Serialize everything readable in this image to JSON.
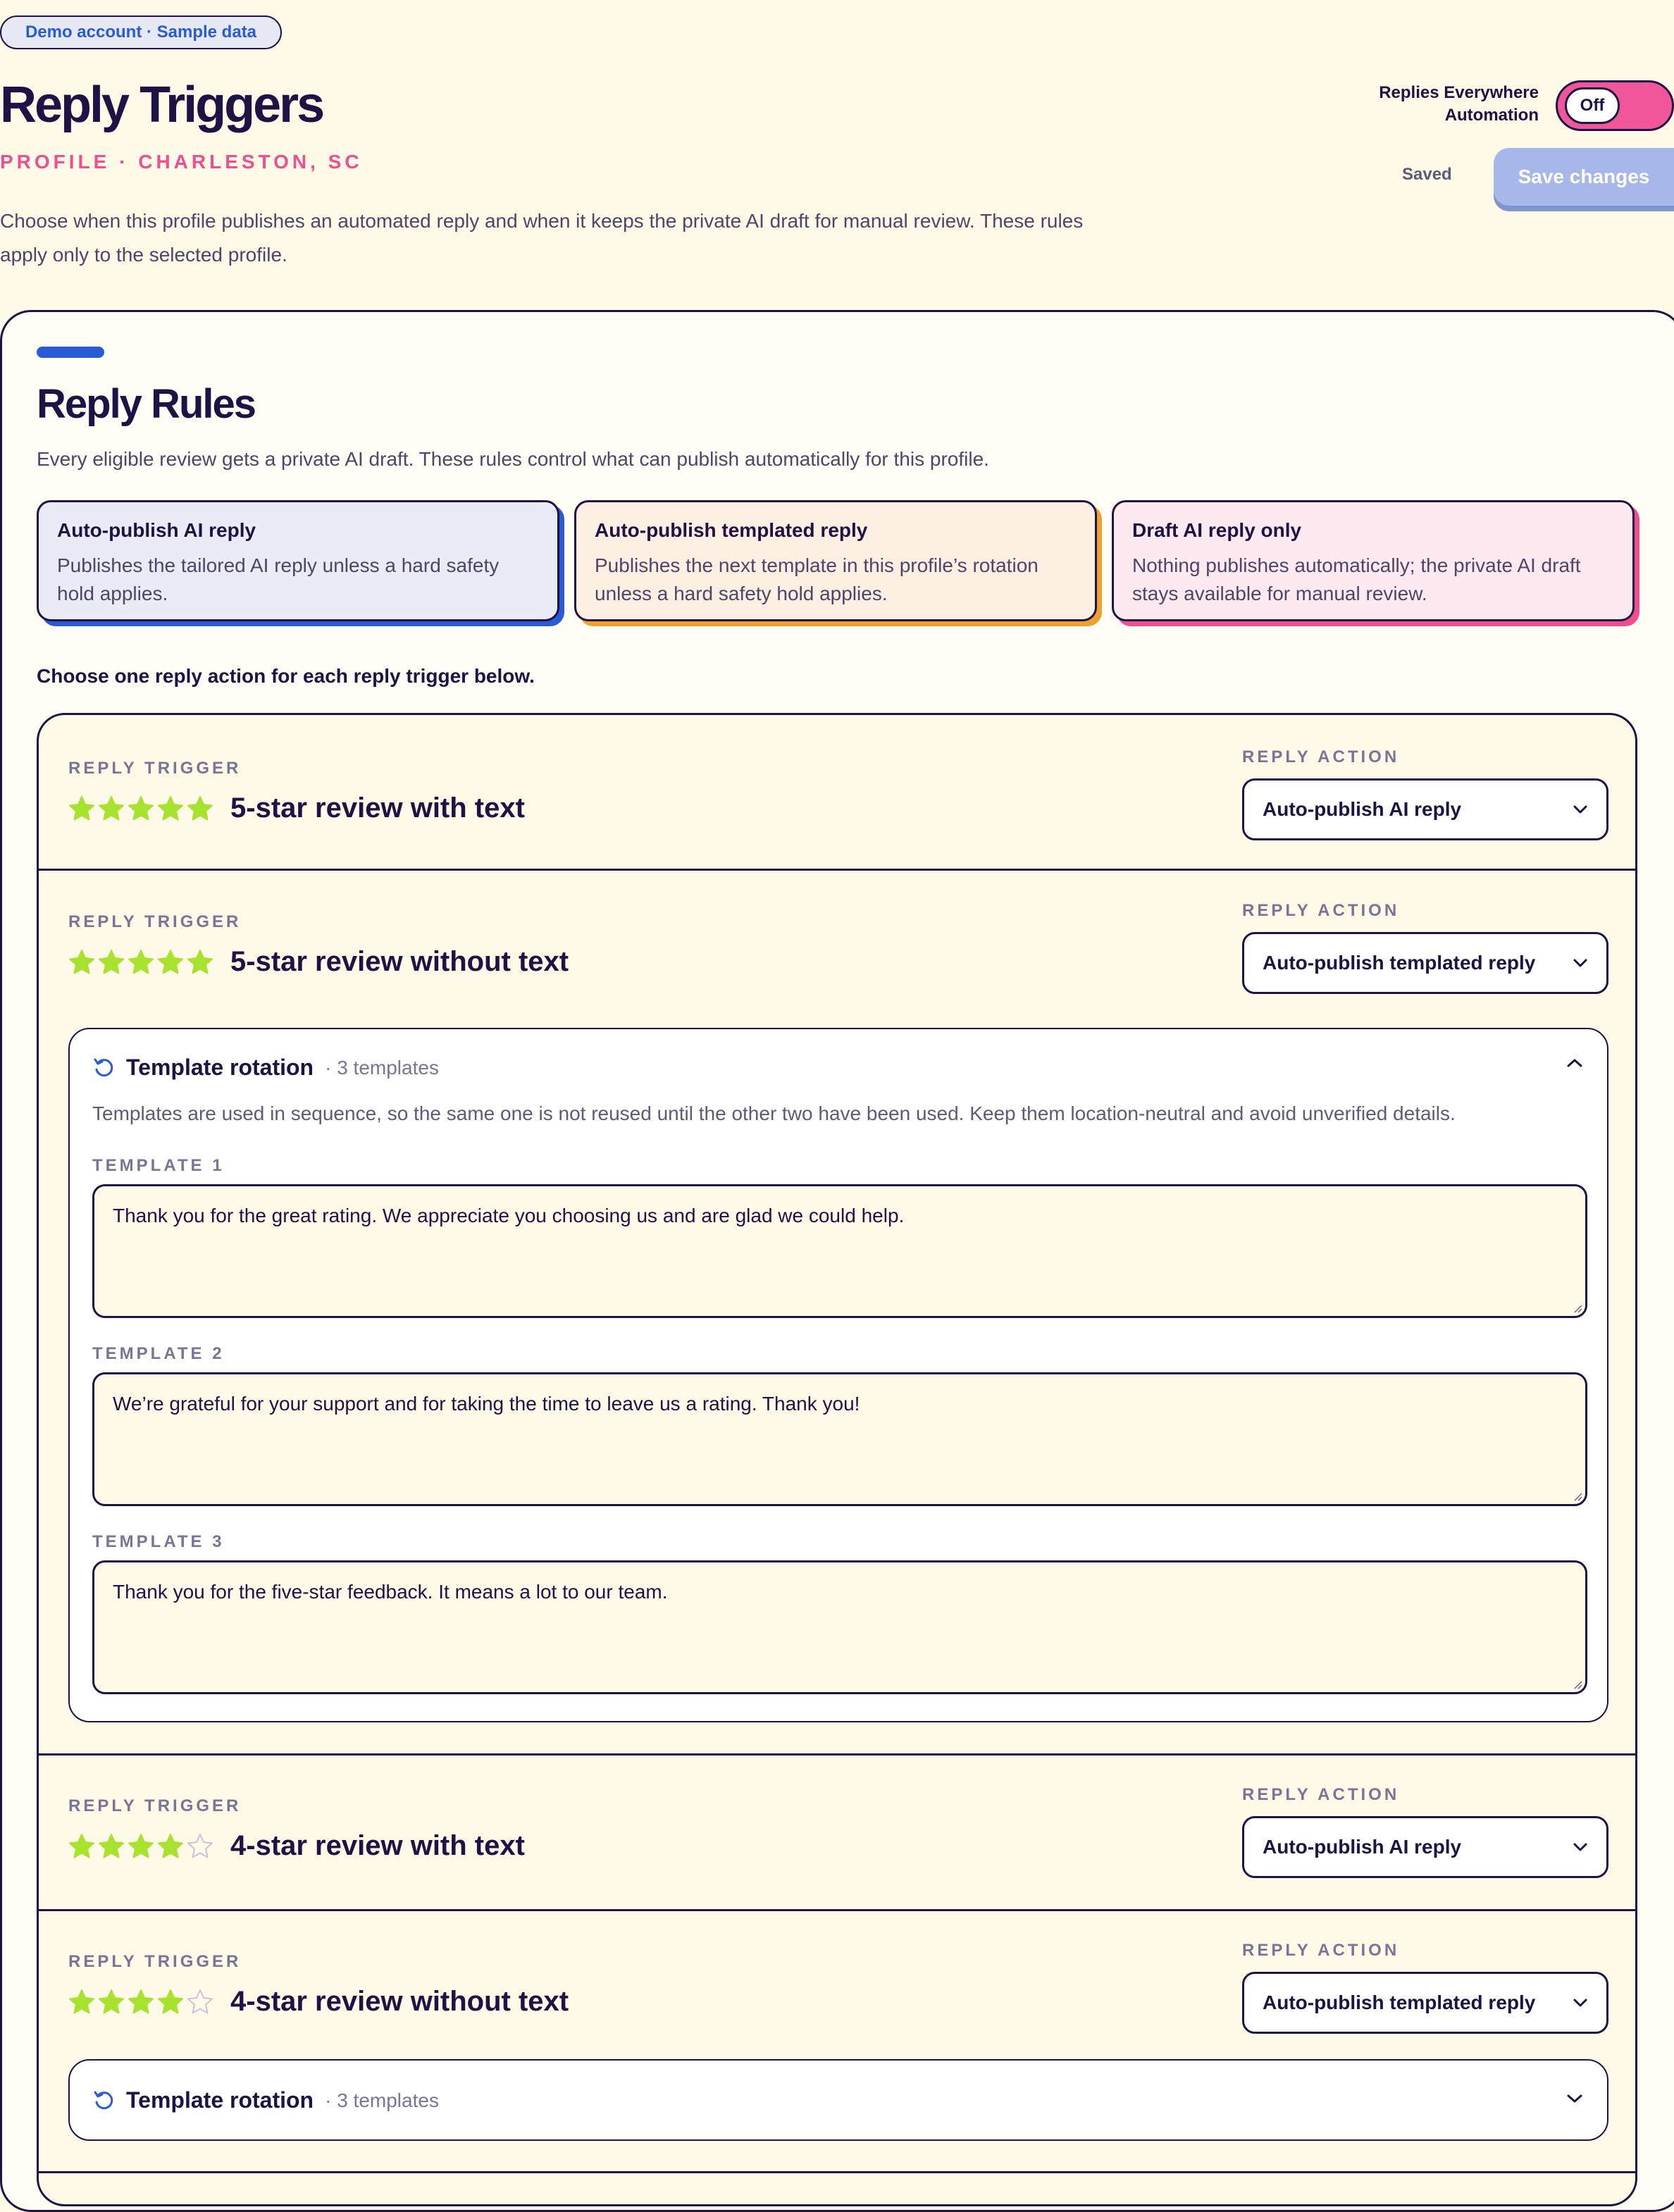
{
  "header": {
    "demo_badge": "Demo account · Sample data",
    "title": "Reply Triggers",
    "subtitle": "PROFILE · CHARLESTON, SC",
    "intro": "Choose when this profile publishes an automated reply and when it keeps the private AI draft for manual review. These rules apply only to the selected profile.",
    "automation_label": "Replies Everywhere Automation",
    "automation_state": "Off",
    "saved_status": "Saved",
    "save_button": "Save changes"
  },
  "rules": {
    "title": "Reply Rules",
    "description": "Every eligible review gets a private AI draft. These rules control what can publish automatically for this profile.",
    "legend": [
      {
        "title": "Auto-publish AI reply",
        "description": "Publishes the tailored AI reply unless a hard safety hold applies.",
        "bg": "#e9ebf6",
        "accent": "#2a5bd6"
      },
      {
        "title": "Auto-publish templated reply",
        "description": "Publishes the next template in this profile’s rotation unless a hard safety hold applies.",
        "bg": "#fdf0e3",
        "accent": "#f0a030"
      },
      {
        "title": "Draft AI reply only",
        "description": "Nothing publishes automatically; the private AI draft stays available for manual review.",
        "bg": "#fdeaf0",
        "accent": "#ef4f8c"
      }
    ],
    "choose_label": "Choose one reply action for each reply trigger below.",
    "trigger_label": "REPLY TRIGGER",
    "action_label": "REPLY ACTION"
  },
  "triggers": [
    {
      "name": "5-star review with text",
      "stars": 5,
      "action": "Auto-publish AI reply"
    },
    {
      "name": "5-star review without text",
      "stars": 5,
      "action": "Auto-publish templated reply"
    },
    {
      "name": "4-star review with text",
      "stars": 4,
      "action": "Auto-publish AI reply"
    },
    {
      "name": "4-star review without text",
      "stars": 4,
      "action": "Auto-publish templated reply"
    }
  ],
  "rotation": {
    "title": "Template rotation",
    "count": "· 3 templates",
    "description": "Templates are used in sequence, so the same one is not reused until the other two have been used. Keep them location-neutral and avoid unverified details.",
    "templates": [
      {
        "label": "TEMPLATE 1",
        "text": "Thank you for the great rating. We appreciate you choosing us and are glad we could help."
      },
      {
        "label": "TEMPLATE 2",
        "text": "We’re grateful for your support and for taking the time to leave us a rating. Thank you!"
      },
      {
        "label": "TEMPLATE 3",
        "text": "Thank you for the five-star feedback. It means a lot to our team."
      }
    ]
  },
  "colors": {
    "star_filled": "#a6e22e",
    "star_empty": "#c9c4d6",
    "ink": "#1f1245",
    "brand_blue": "#2a5bd6",
    "brand_pink": "#ef4f8c"
  }
}
